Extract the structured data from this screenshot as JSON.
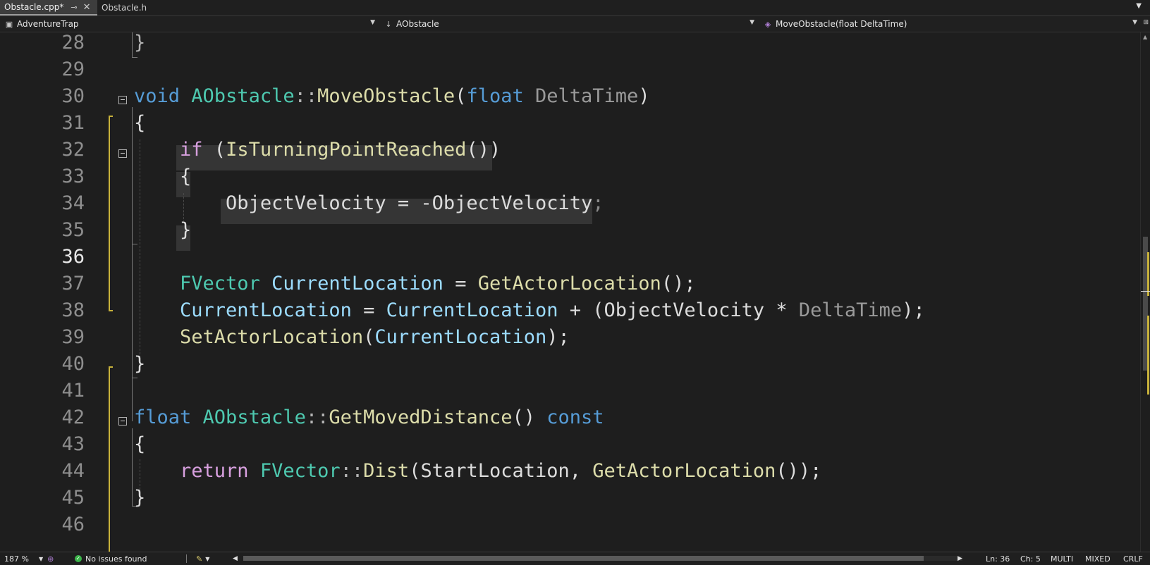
{
  "tabs": [
    {
      "label": "Obstacle.cpp*",
      "active": true
    },
    {
      "label": "Obstacle.h",
      "active": false
    }
  ],
  "navbar": {
    "project": "AdventureTrap",
    "class": "AObstacle",
    "member": "MoveObstacle(float DeltaTime)"
  },
  "editor": {
    "current_line": 36,
    "line_numbers": [
      "28",
      "29",
      "30",
      "31",
      "32",
      "33",
      "34",
      "35",
      "36",
      "37",
      "38",
      "39",
      "40",
      "41",
      "42",
      "43",
      "44",
      "45",
      "46"
    ],
    "lines": [
      [
        {
          "t": "}",
          "c": "op"
        }
      ],
      [],
      [
        {
          "t": "void",
          "c": "kw"
        },
        {
          "t": " "
        },
        {
          "t": "AObstacle",
          "c": "typ"
        },
        {
          "t": "::",
          "c": "op"
        },
        {
          "t": "MoveObstacle",
          "c": "fn"
        },
        {
          "t": "("
        },
        {
          "t": "float",
          "c": "kw"
        },
        {
          "t": " "
        },
        {
          "t": "DeltaTime",
          "c": "prm"
        },
        {
          "t": ")"
        }
      ],
      [
        {
          "t": "{"
        }
      ],
      [
        {
          "t": "    "
        },
        {
          "t": "if",
          "c": "ctl"
        },
        {
          "t": " ("
        },
        {
          "t": "IsTurningPointReached",
          "c": "fn"
        },
        {
          "t": "())"
        }
      ],
      [
        {
          "t": "    {"
        }
      ],
      [
        {
          "t": "        "
        },
        {
          "t": "ObjectVelocity",
          "c": ""
        },
        {
          "t": " = -"
        },
        {
          "t": "ObjectVelocity",
          "c": ""
        },
        {
          "t": ";",
          "c": "sc"
        }
      ],
      [
        {
          "t": "    }"
        }
      ],
      [],
      [
        {
          "t": "    "
        },
        {
          "t": "FVector",
          "c": "typ"
        },
        {
          "t": " "
        },
        {
          "t": "CurrentLocation",
          "c": "var"
        },
        {
          "t": " = "
        },
        {
          "t": "GetActorLocation",
          "c": "fn"
        },
        {
          "t": "();"
        }
      ],
      [
        {
          "t": "    "
        },
        {
          "t": "CurrentLocation",
          "c": "var"
        },
        {
          "t": " = "
        },
        {
          "t": "CurrentLocation",
          "c": "var"
        },
        {
          "t": " + ("
        },
        {
          "t": "ObjectVelocity",
          "c": ""
        },
        {
          "t": " * "
        },
        {
          "t": "DeltaTime",
          "c": "prm"
        },
        {
          "t": ");"
        }
      ],
      [
        {
          "t": "    "
        },
        {
          "t": "SetActorLocation",
          "c": "fn"
        },
        {
          "t": "("
        },
        {
          "t": "CurrentLocation",
          "c": "var"
        },
        {
          "t": ");"
        }
      ],
      [
        {
          "t": "}"
        }
      ],
      [],
      [
        {
          "t": "float",
          "c": "kw"
        },
        {
          "t": " "
        },
        {
          "t": "AObstacle",
          "c": "typ"
        },
        {
          "t": "::",
          "c": "op"
        },
        {
          "t": "GetMovedDistance",
          "c": "fn"
        },
        {
          "t": "() "
        },
        {
          "t": "const",
          "c": "kw"
        }
      ],
      [
        {
          "t": "{"
        }
      ],
      [
        {
          "t": "    "
        },
        {
          "t": "return",
          "c": "ctl"
        },
        {
          "t": " "
        },
        {
          "t": "FVector",
          "c": "typ"
        },
        {
          "t": "::",
          "c": "op"
        },
        {
          "t": "Dist",
          "c": "fn"
        },
        {
          "t": "("
        },
        {
          "t": "StartLocation",
          "c": ""
        },
        {
          "t": ", "
        },
        {
          "t": "GetActorLocation",
          "c": "fn"
        },
        {
          "t": "());"
        }
      ],
      [
        {
          "t": "}"
        }
      ],
      []
    ]
  },
  "status": {
    "zoom": "187 %",
    "issues": "No issues found",
    "ln": "Ln: 36",
    "ch": "Ch: 5",
    "encoding1": "MULTI",
    "encoding2": "MIXED",
    "eol": "CRLF"
  },
  "colors": {
    "keyword": "#569cd6",
    "control": "#d8a0df",
    "type": "#4ec9b0",
    "function": "#dcdcaa",
    "variable": "#9cdcfe",
    "change_marker": "#c8b23b"
  }
}
